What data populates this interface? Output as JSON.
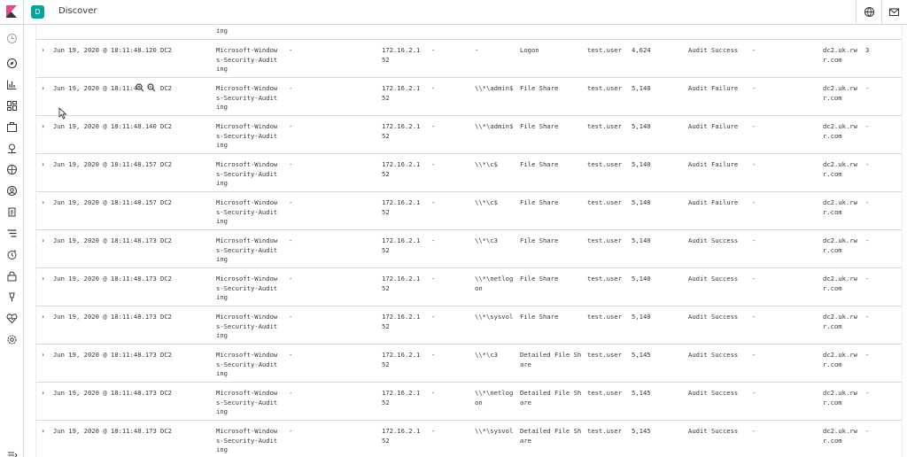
{
  "app": {
    "title": "Discover",
    "badge": "D",
    "colors": {
      "accent": "#00a69b",
      "logo_pink": "#e8478b",
      "logo_dark": "#343741"
    }
  },
  "topbar_icons": [
    "help-icon",
    "mail-icon"
  ],
  "sidenav_icons": [
    "clock-icon",
    "discover-icon",
    "visualize-icon",
    "dashboard-icon",
    "canvas-icon",
    "maps-icon",
    "machine-learning-icon",
    "infrastructure-icon",
    "logs-icon",
    "apm-icon",
    "uptime-icon",
    "siem-icon",
    "dev-tools-icon",
    "monitoring-icon",
    "management-icon",
    "collapse-icon"
  ],
  "table": {
    "top_fragment": "ing",
    "rows": [
      {
        "time": "Jun 19, 2020 @ 18:11:48.120",
        "host": "DC2",
        "provider": "Microsoft-Window\ns-Security-Audit\ning",
        "col4": "-",
        "ip": "172.16.2.1\n52",
        "col6": "-",
        "share": "-",
        "task": "Logon",
        "user": "test.user",
        "event_id": "4,624",
        "outcome": "Audit Success",
        "col12": "-",
        "domain": "dc2.uk.rw\nr.com",
        "last": "3"
      },
      {
        "time": "Jun 19, 2020 @ 18:11:4",
        "zoom": true,
        "host": "DC2",
        "provider": "Microsoft-Window\ns-Security-Audit\ning",
        "col4": "-",
        "ip": "172.16.2.1\n52",
        "col6": "-",
        "share": "\\\\*\\admin$",
        "task": "File Share",
        "user": "test.user",
        "event_id": "5,140",
        "outcome": "Audit Failure",
        "col12": "-",
        "domain": "dc2.uk.rw\nr.com",
        "last": "-"
      },
      {
        "time": "Jun 19, 2020 @ 18:11:48.140",
        "host": "DC2",
        "provider": "Microsoft-Window\ns-Security-Audit\ning",
        "col4": "-",
        "ip": "172.16.2.1\n52",
        "col6": "-",
        "share": "\\\\*\\admin$",
        "task": "File Share",
        "user": "test.user",
        "event_id": "5,140",
        "outcome": "Audit Failure",
        "col12": "-",
        "domain": "dc2.uk.rw\nr.com",
        "last": "-"
      },
      {
        "time": "Jun 19, 2020 @ 18:11:48.157",
        "host": "DC2",
        "provider": "Microsoft-Window\ns-Security-Audit\ning",
        "col4": "-",
        "ip": "172.16.2.1\n52",
        "col6": "-",
        "share": "\\\\*\\c$",
        "task": "File Share",
        "user": "test.user",
        "event_id": "5,140",
        "outcome": "Audit Failure",
        "col12": "-",
        "domain": "dc2.uk.rw\nr.com",
        "last": "-"
      },
      {
        "time": "Jun 19, 2020 @ 18:11:48.157",
        "host": "DC2",
        "provider": "Microsoft-Window\ns-Security-Audit\ning",
        "col4": "-",
        "ip": "172.16.2.1\n52",
        "col6": "-",
        "share": "\\\\*\\c$",
        "task": "File Share",
        "user": "test.user",
        "event_id": "5,140",
        "outcome": "Audit Failure",
        "col12": "-",
        "domain": "dc2.uk.rw\nr.com",
        "last": "-"
      },
      {
        "time": "Jun 19, 2020 @ 18:11:48.173",
        "host": "DC2",
        "provider": "Microsoft-Window\ns-Security-Audit\ning",
        "col4": "-",
        "ip": "172.16.2.1\n52",
        "col6": "-",
        "share": "\\\\*\\c3",
        "task": "File Share",
        "user": "test.user",
        "event_id": "5,140",
        "outcome": "Audit Success",
        "col12": "-",
        "domain": "dc2.uk.rw\nr.com",
        "last": "-"
      },
      {
        "time": "Jun 19, 2020 @ 18:11:48.173",
        "host": "DC2",
        "provider": "Microsoft-Window\ns-Security-Audit\ning",
        "col4": "-",
        "ip": "172.16.2.1\n52",
        "col6": "-",
        "share": "\\\\*\\netlog\non",
        "task": "File Share",
        "user": "test.user",
        "event_id": "5,140",
        "outcome": "Audit Success",
        "col12": "-",
        "domain": "dc2.uk.rw\nr.com",
        "last": "-"
      },
      {
        "time": "Jun 19, 2020 @ 18:11:48.173",
        "host": "DC2",
        "provider": "Microsoft-Window\ns-Security-Audit\ning",
        "col4": "-",
        "ip": "172.16.2.1\n52",
        "col6": "-",
        "share": "\\\\*\\sysvol",
        "task": "File Share",
        "user": "test.user",
        "event_id": "5,140",
        "outcome": "Audit Success",
        "col12": "-",
        "domain": "dc2.uk.rw\nr.com",
        "last": "-"
      },
      {
        "time": "Jun 19, 2020 @ 18:11:48.173",
        "host": "DC2",
        "provider": "Microsoft-Window\ns-Security-Audit\ning",
        "col4": "-",
        "ip": "172.16.2.1\n52",
        "col6": "-",
        "share": "\\\\*\\c3",
        "task": "Detailed File Sh\nare",
        "user": "test.user",
        "event_id": "5,145",
        "outcome": "Audit Success",
        "col12": "-",
        "domain": "dc2.uk.rw\nr.com",
        "last": "-"
      },
      {
        "time": "Jun 19, 2020 @ 18:11:48.173",
        "host": "DC2",
        "provider": "Microsoft-Window\ns-Security-Audit\ning",
        "col4": "-",
        "ip": "172.16.2.1\n52",
        "col6": "-",
        "share": "\\\\*\\netlog\non",
        "task": "Detailed File Sh\nare",
        "user": "test.user",
        "event_id": "5,145",
        "outcome": "Audit Success",
        "col12": "-",
        "domain": "dc2.uk.rw\nr.com",
        "last": "-"
      },
      {
        "time": "Jun 19, 2020 @ 18:11:48.173",
        "host": "DC2",
        "provider": "Microsoft-Window\ns-Security-Audit\ning",
        "col4": "-",
        "ip": "172.16.2.1\n52",
        "col6": "-",
        "share": "\\\\*\\sysvol",
        "task": "Detailed File Sh\nare",
        "user": "test.user",
        "event_id": "5,145",
        "outcome": "Audit Success",
        "col12": "-",
        "domain": "dc2.uk.rw\nr.com",
        "last": "-"
      }
    ]
  }
}
